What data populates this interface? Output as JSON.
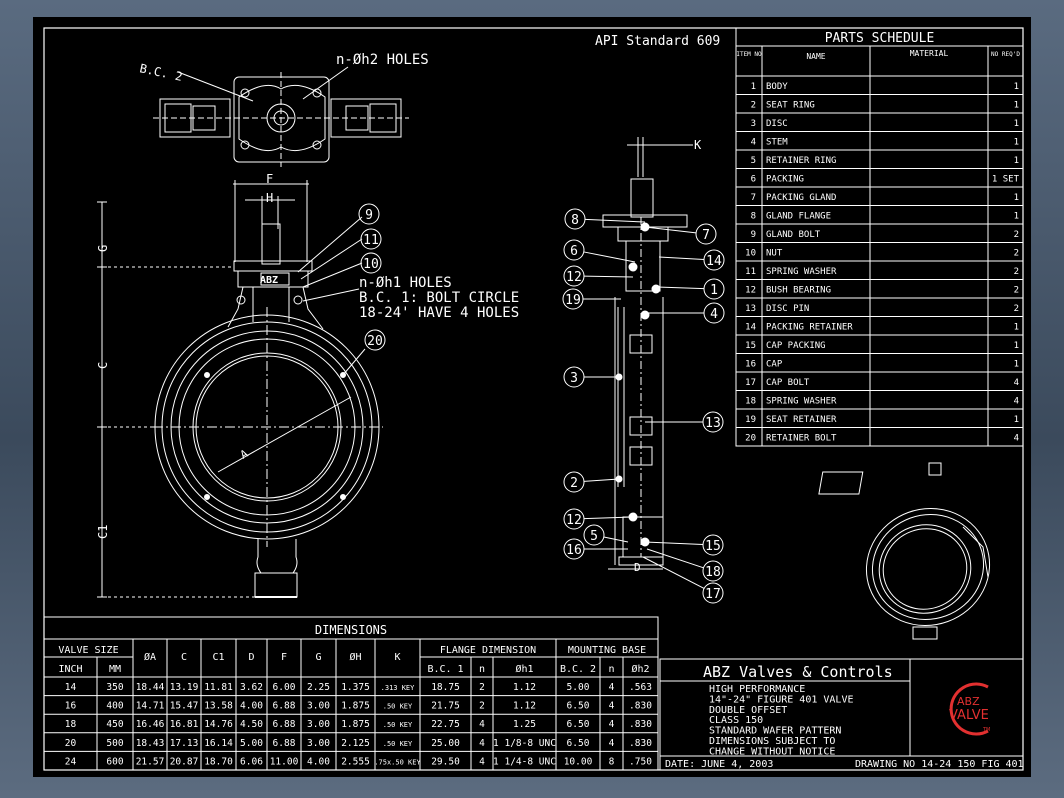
{
  "standard": "API Standard 609",
  "top_view": {
    "bc_label": "B.C. 2",
    "holes_label": "n-Øh2 HOLES"
  },
  "dims": {
    "F": "F",
    "H": "H",
    "G": "G",
    "C": "C",
    "C1": "C1",
    "A": "A",
    "K": "K",
    "D": "D"
  },
  "brand_mark": "ABZ",
  "hole_notes": [
    "n-Øh1 HOLES",
    "B.C. 1: BOLT CIRCLE",
    "18-24' HAVE 4 HOLES"
  ],
  "balloons": {
    "front": [
      "9",
      "11",
      "10",
      "20"
    ],
    "section_left": [
      "8",
      "6",
      "12",
      "19",
      "3",
      "2",
      "12",
      "5",
      "16"
    ],
    "section_right": [
      "7",
      "14",
      "1",
      "4",
      "13",
      "15",
      "18",
      "17"
    ]
  },
  "parts_schedule": {
    "title": "PARTS SCHEDULE",
    "headers": [
      "ITEM NO",
      "NAME",
      "MATERIAL",
      "NO REQ'D"
    ],
    "rows": [
      {
        "no": "1",
        "name": "BODY",
        "material": "",
        "qty": "1"
      },
      {
        "no": "2",
        "name": "SEAT RING",
        "material": "",
        "qty": "1"
      },
      {
        "no": "3",
        "name": "DISC",
        "material": "",
        "qty": "1"
      },
      {
        "no": "4",
        "name": "STEM",
        "material": "",
        "qty": "1"
      },
      {
        "no": "5",
        "name": "RETAINER RING",
        "material": "",
        "qty": "1"
      },
      {
        "no": "6",
        "name": "PACKING",
        "material": "",
        "qty": "1 SET"
      },
      {
        "no": "7",
        "name": "PACKING GLAND",
        "material": "",
        "qty": "1"
      },
      {
        "no": "8",
        "name": "GLAND FLANGE",
        "material": "",
        "qty": "1"
      },
      {
        "no": "9",
        "name": "GLAND BOLT",
        "material": "",
        "qty": "2"
      },
      {
        "no": "10",
        "name": "NUT",
        "material": "",
        "qty": "2"
      },
      {
        "no": "11",
        "name": "SPRING WASHER",
        "material": "",
        "qty": "2"
      },
      {
        "no": "12",
        "name": "BUSH BEARING",
        "material": "",
        "qty": "2"
      },
      {
        "no": "13",
        "name": "DISC PIN",
        "material": "",
        "qty": "2"
      },
      {
        "no": "14",
        "name": "PACKING RETAINER",
        "material": "",
        "qty": "1"
      },
      {
        "no": "15",
        "name": "CAP PACKING",
        "material": "",
        "qty": "1"
      },
      {
        "no": "16",
        "name": "CAP",
        "material": "",
        "qty": "1"
      },
      {
        "no": "17",
        "name": "CAP BOLT",
        "material": "",
        "qty": "4"
      },
      {
        "no": "18",
        "name": "SPRING WASHER",
        "material": "",
        "qty": "4"
      },
      {
        "no": "19",
        "name": "SEAT RETAINER",
        "material": "",
        "qty": "1"
      },
      {
        "no": "20",
        "name": "RETAINER BOLT",
        "material": "",
        "qty": "4"
      }
    ]
  },
  "dimensions": {
    "title": "DIMENSIONS",
    "group_valve_size": "VALVE SIZE",
    "group_flange": "FLANGE DIMENSION",
    "group_mounting": "MOUNTING BASE",
    "columns": [
      "INCH",
      "MM",
      "ØA",
      "C",
      "C1",
      "D",
      "F",
      "G",
      "ØH",
      "K",
      "B.C. 1",
      "n",
      "Øh1",
      "B.C. 2",
      "n",
      "Øh2"
    ],
    "rows": [
      [
        "14",
        "350",
        "18.44",
        "13.19",
        "11.81",
        "3.62",
        "6.00",
        "2.25",
        "1.375",
        ".313 KEY",
        "18.75",
        "2",
        "1.12",
        "5.00",
        "4",
        ".563"
      ],
      [
        "16",
        "400",
        "14.71",
        "15.47",
        "13.58",
        "4.00",
        "6.88",
        "3.00",
        "1.875",
        ".50 KEY",
        "21.75",
        "2",
        "1.12",
        "6.50",
        "4",
        ".830"
      ],
      [
        "18",
        "450",
        "16.46",
        "16.81",
        "14.76",
        "4.50",
        "6.88",
        "3.00",
        "1.875",
        ".50 KEY",
        "22.75",
        "4",
        "1.25",
        "6.50",
        "4",
        ".830"
      ],
      [
        "20",
        "500",
        "18.43",
        "17.13",
        "16.14",
        "5.00",
        "6.88",
        "3.00",
        "2.125",
        ".50 KEY",
        "25.00",
        "4",
        "1 1/8-8 UNC",
        "6.50",
        "4",
        ".830"
      ],
      [
        "24",
        "600",
        "21.57",
        "20.87",
        "18.70",
        "6.06",
        "11.00",
        "4.00",
        "2.555",
        ".75x.50 KEY",
        "29.50",
        "4",
        "1 1/4-8 UNC",
        "10.00",
        "8",
        ".750"
      ]
    ]
  },
  "title_block": {
    "company": "ABZ Valves & Controls",
    "description": [
      "HIGH PERFORMANCE",
      "14\"-24\" FIGURE  401 VALVE",
      "DOUBLE OFFSET",
      "CLASS 150",
      "STANDARD WAFER PATTERN",
      "DIMENSIONS SUBJECT TO",
      "CHANGE WITHOUT NOTICE"
    ],
    "date": "DATE: JUNE 4, 2003",
    "drawing_no": "DRAWING NO 14-24 150 FIG 401",
    "logo_text": [
      "ABZ",
      "VALVE"
    ],
    "logo_tm": "TM"
  }
}
